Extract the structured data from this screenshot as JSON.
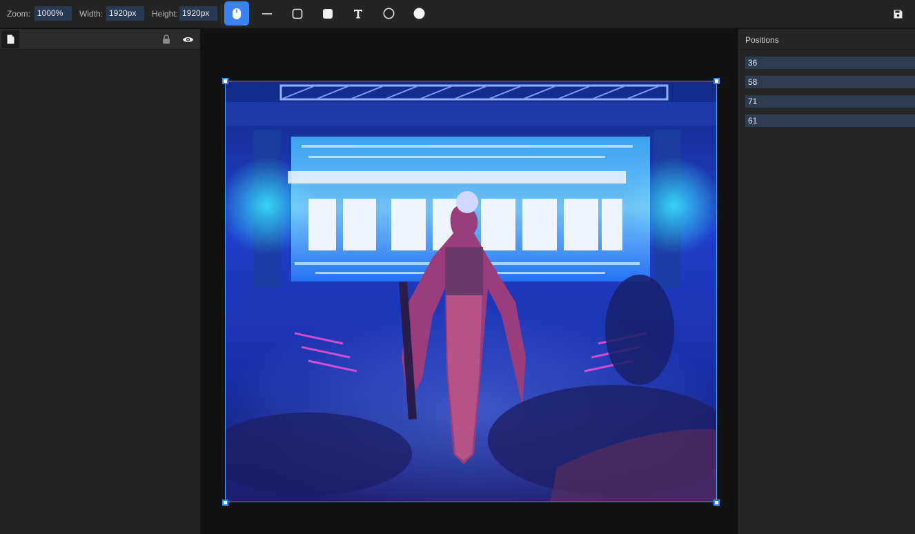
{
  "toolbar": {
    "zoom_label": "Zoom:",
    "zoom_value": "1000%",
    "width_label": "Width:",
    "width_value": "1920px",
    "height_label": "Height:",
    "height_value": "1920px",
    "tools": [
      {
        "name": "select-tool",
        "icon": "mouse-icon",
        "active": true
      },
      {
        "name": "line-tool",
        "icon": "line-icon",
        "active": false
      },
      {
        "name": "rounded-rect-tool",
        "icon": "rounded-square-outline-icon",
        "active": false
      },
      {
        "name": "filled-rect-tool",
        "icon": "rounded-square-filled-icon",
        "active": false
      },
      {
        "name": "text-tool",
        "icon": "text-t-icon",
        "active": false
      },
      {
        "name": "circle-tool",
        "icon": "circle-outline-icon",
        "active": false
      },
      {
        "name": "filled-circle-tool",
        "icon": "circle-filled-icon",
        "active": false
      }
    ],
    "save_icon": "floppy-disk-icon",
    "accent_color": "#3b82f6"
  },
  "layers": {
    "items": [
      {
        "name": "",
        "icon": "file-icon",
        "locked_icon": "lock-icon",
        "visible_icon": "eye-icon"
      }
    ]
  },
  "canvas": {
    "image_description_icon": "artwork-image",
    "selection_color": "#3ba0ff"
  },
  "positions_panel": {
    "title": "Positions",
    "fields": [
      "36",
      "58",
      "71",
      "61"
    ]
  }
}
